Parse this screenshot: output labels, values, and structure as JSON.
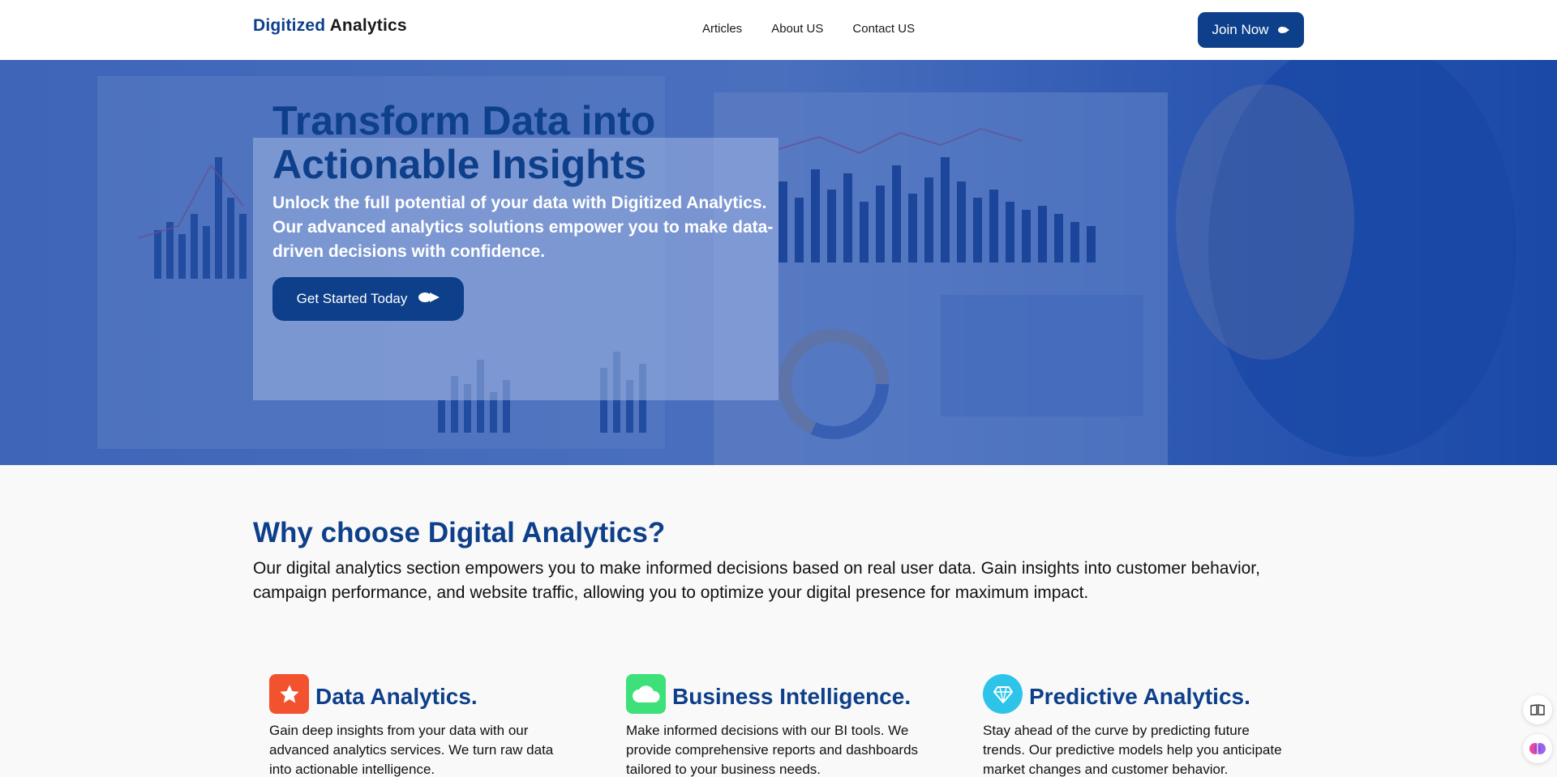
{
  "header": {
    "logo_brand": "Digitized",
    "logo_rest": "Analytics",
    "nav": [
      "Articles",
      "About US",
      "Contact US"
    ],
    "join_label": "Join Now",
    "join_icon": "arrow-icon"
  },
  "hero": {
    "title": "Transform Data into Actionable Insights",
    "subtitle": "Unlock the full potential of your data with Digitized Analytics. Our advanced analytics solutions empower you to make data-driven decisions with confidence.",
    "cta_label": "Get Started Today",
    "cta_icon": "arrow-icon",
    "background": "analyst viewing dashboards on monitors (blue tint)"
  },
  "why": {
    "title": "Why choose Digital Analytics?",
    "text": "Our digital analytics section empowers you to make informed decisions based on real user data. Gain insights into customer behavior, campaign performance, and website traffic, allowing you to optimize your digital presence for maximum impact."
  },
  "features": [
    {
      "title": "Data Analytics.",
      "text": "Gain deep insights from your data with our advanced analytics services. We turn raw data into actionable intelligence.",
      "icon": "star-icon",
      "color": "#f2532e"
    },
    {
      "title": "Business Intelligence.",
      "text": "Make informed decisions with our BI tools. We provide comprehensive reports and dashboards tailored to your business needs.",
      "icon": "cloud-icon",
      "color": "#3ee07a"
    },
    {
      "title": "Predictive Analytics.",
      "text": "Stay ahead of the curve by predicting future trends. Our predictive models help you anticipate market changes and customer behavior.",
      "icon": "diamond-icon",
      "color": "#2ec4ea"
    }
  ],
  "colors": {
    "primary": "#0d3f8a",
    "hero_tint": "#2e5fb3"
  }
}
